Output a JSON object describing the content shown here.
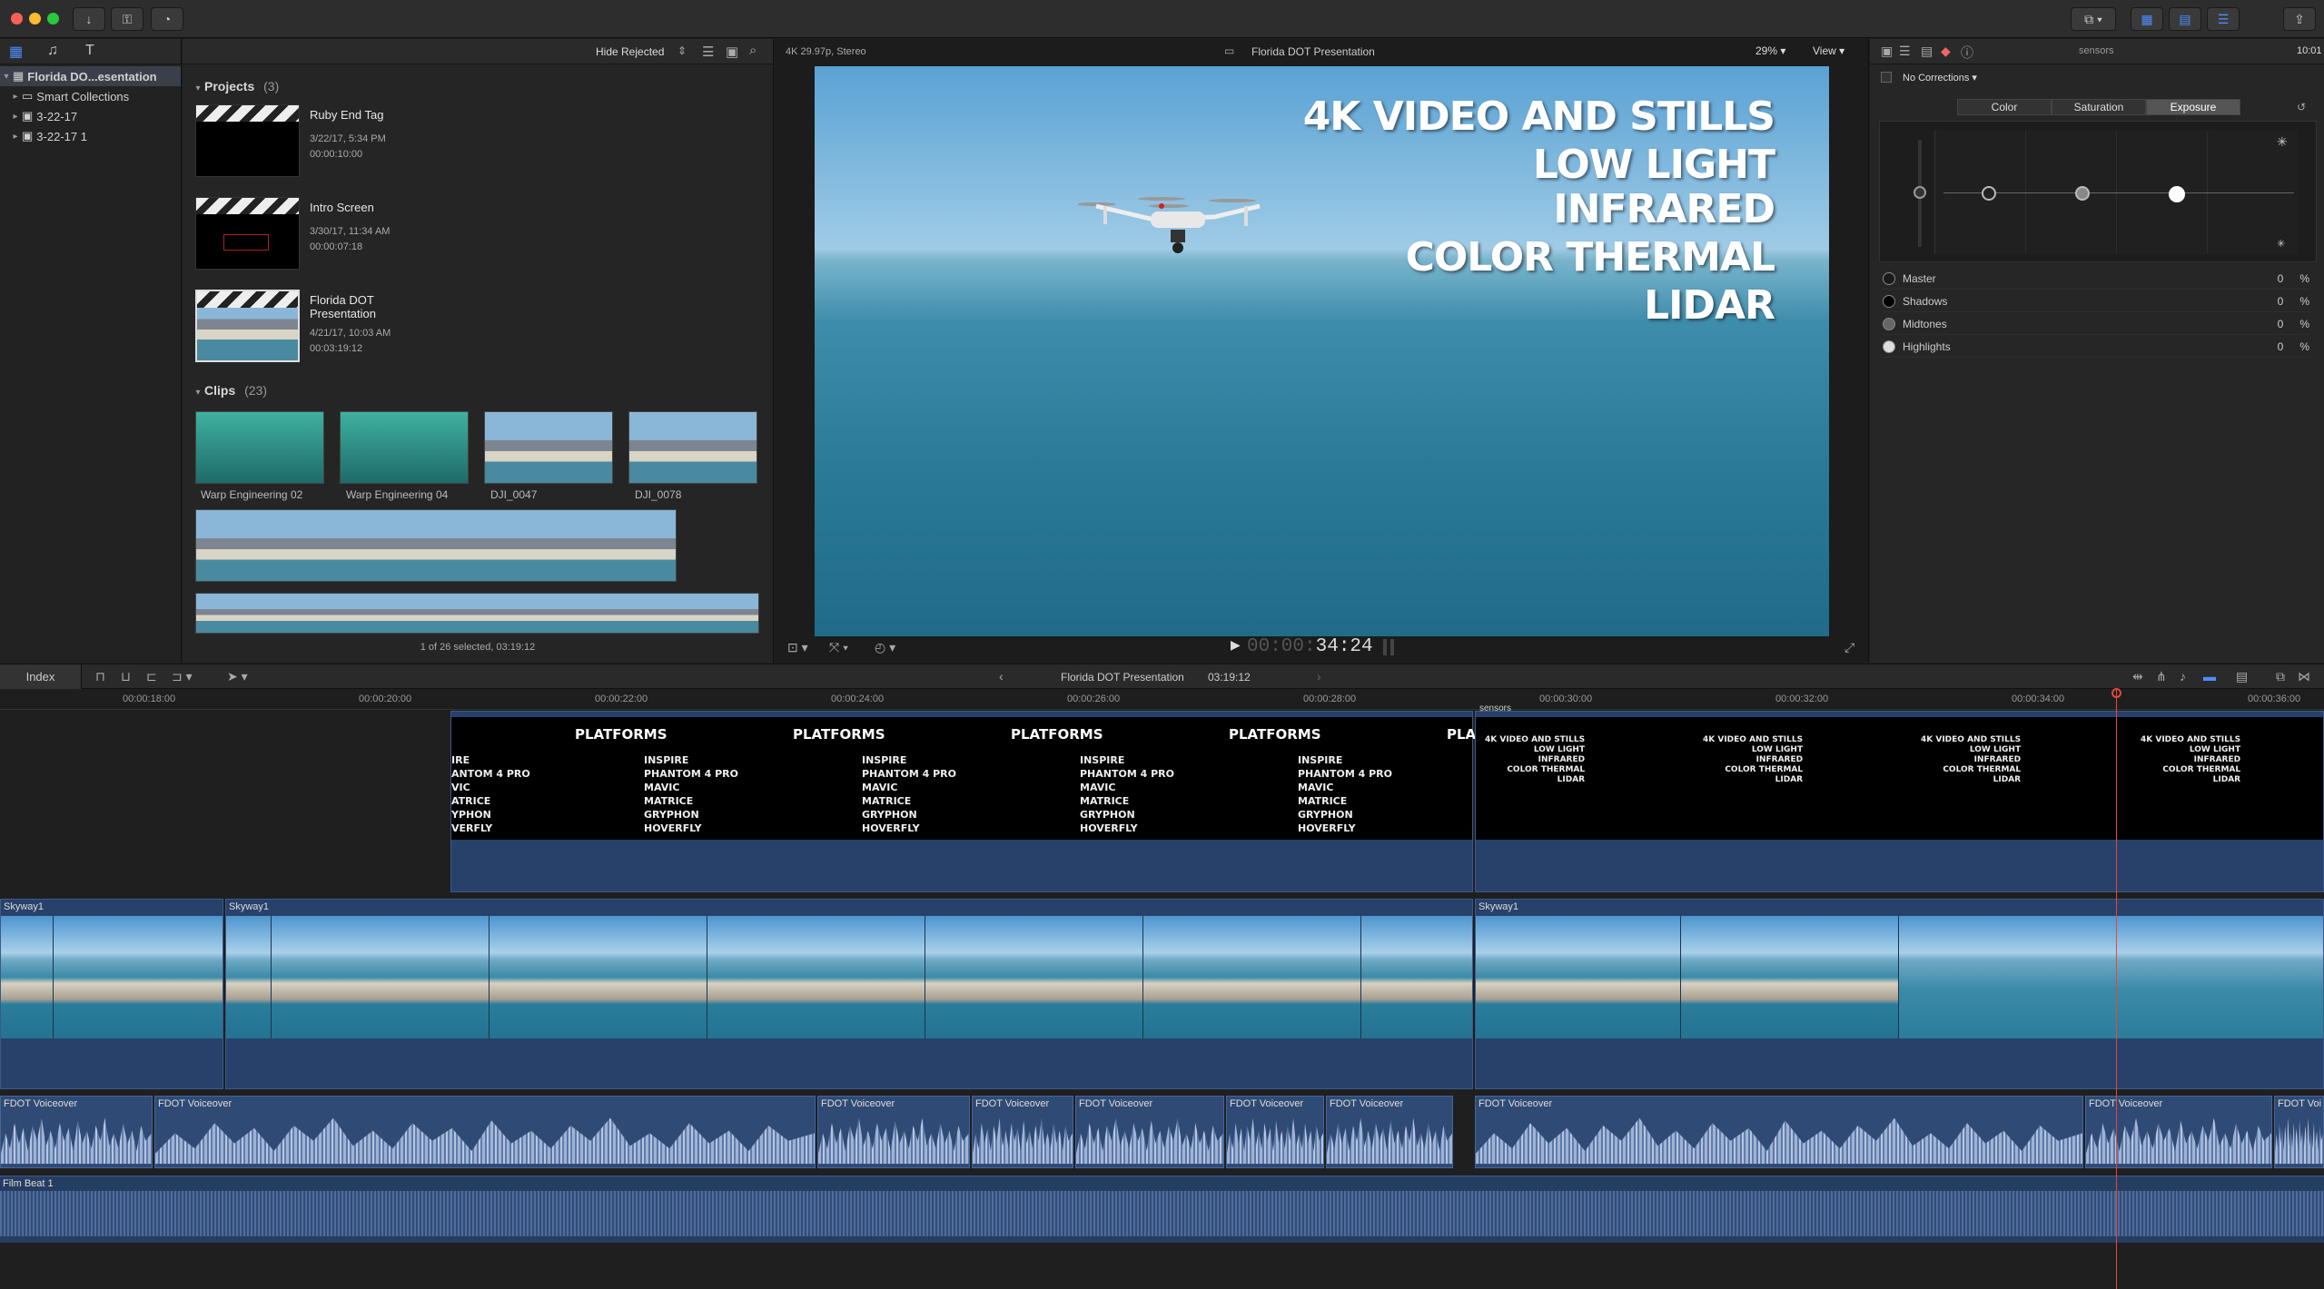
{
  "window": {
    "title": "Florida DOT Presentation"
  },
  "browser": {
    "filter": "Hide Rejected",
    "library": "Florida DO...esentation",
    "sidebar": [
      {
        "label": "Smart Collections"
      },
      {
        "label": "3-22-17"
      },
      {
        "label": "3-22-17 1"
      }
    ],
    "projects_label": "Projects",
    "projects_count": "(3)",
    "projects": [
      {
        "name": "Ruby End Tag",
        "date": "3/22/17, 5:34 PM",
        "duration": "00:00:10:00"
      },
      {
        "name": "Intro Screen",
        "date": "3/30/17, 11:34 AM",
        "duration": "00:00:07:18"
      },
      {
        "name": "Florida DOT\nPresentation",
        "date": "4/21/17, 10:03 AM",
        "duration": "00:03:19:12"
      }
    ],
    "clips_label": "Clips",
    "clips_count": "(23)",
    "clips": [
      {
        "name": "Warp Engineering 02"
      },
      {
        "name": "Warp Engineering 04"
      },
      {
        "name": "DJI_0047"
      },
      {
        "name": "DJI_0078"
      }
    ],
    "footer": "1 of 26 selected, 03:19:12"
  },
  "viewer": {
    "format": "4K 29.97p, Stereo",
    "title": "Florida DOT Presentation",
    "zoom": "29%",
    "view_label": "View",
    "timecode_dim": "00:00:",
    "timecode": "34:24",
    "overlay": [
      "4K VIDEO AND STILLS",
      "LOW LIGHT",
      "INFRARED",
      "COLOR THERMAL",
      "LIDAR"
    ]
  },
  "inspector": {
    "clip_name": "sensors",
    "timecode": "10:01",
    "corrections": "No Corrections",
    "tabs": [
      "Color",
      "Saturation",
      "Exposure"
    ],
    "active_tab": "Exposure",
    "rows": [
      {
        "label": "Master",
        "value": "0",
        "unit": "%"
      },
      {
        "label": "Shadows",
        "value": "0",
        "unit": "%"
      },
      {
        "label": "Midtones",
        "value": "0",
        "unit": "%"
      },
      {
        "label": "Highlights",
        "value": "0",
        "unit": "%"
      }
    ]
  },
  "timeline": {
    "index_label": "Index",
    "project": "Florida DOT Presentation",
    "duration": "03:19:12",
    "ruler": [
      "00:00:18:00",
      "00:00:20:00",
      "00:00:22:00",
      "00:00:24:00",
      "00:00:26:00",
      "00:00:28:00",
      "00:00:30:00",
      "00:00:32:00",
      "00:00:34:00",
      "00:00:36:00"
    ],
    "title_clip": {
      "platforms": "PLATFORMS",
      "platforms_short": "PLAT",
      "list": [
        "INSPIRE",
        "PHANTOM 4 PRO",
        "MAVIC",
        "MATRICE",
        "GRYPHON",
        "HOVERFLY"
      ],
      "list_cut": [
        "IRE",
        "ANTOM 4 PRO",
        "VIC",
        "ATRICE",
        "YPHON",
        "VERFLY"
      ],
      "sensors_label": "sensors",
      "sensors_lines": [
        "4K VIDEO AND STILLS",
        "LOW LIGHT",
        "INFRARED",
        "COLOR THERMAL",
        "LIDAR"
      ]
    },
    "video_clip": "Skyway1",
    "audio_clip": "FDOT Voiceover",
    "audio_clip_cut": "FDOT Voi",
    "music_clip": "Film Beat 1"
  }
}
